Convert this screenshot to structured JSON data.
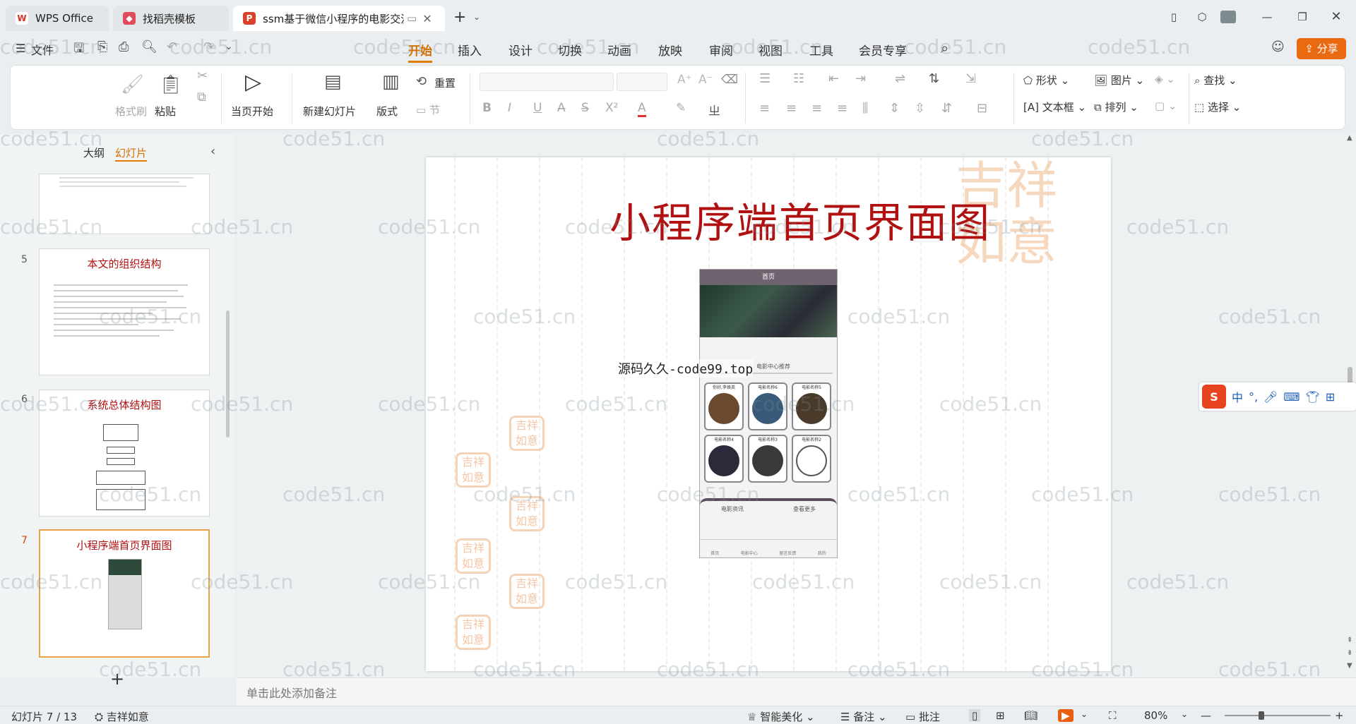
{
  "tabs": [
    {
      "label": "WPS Office",
      "icon": "wps-icon"
    },
    {
      "label": "找稻壳模板",
      "icon": "docer-icon"
    },
    {
      "label": "ssm基于微信小程序的电影交流",
      "icon": "ppt-icon"
    }
  ],
  "menu": {
    "file": "文件",
    "tabs": [
      "开始",
      "插入",
      "设计",
      "切换",
      "动画",
      "放映",
      "审阅",
      "视图",
      "工具",
      "会员专享"
    ],
    "active": "开始",
    "share": "分享"
  },
  "ribbon": {
    "format_painter": "格式刷",
    "paste": "粘贴",
    "start_from_current": "当页开始",
    "new_slide": "新建幻灯片",
    "layout": "版式",
    "reset": "重置",
    "section": "节",
    "shape": "形状",
    "picture": "图片",
    "textbox": "文本框",
    "arrange": "排列",
    "find": "查找",
    "select": "选择"
  },
  "panel": {
    "outline_tab": "大纲",
    "slides_tab": "幻灯片"
  },
  "thumbs": [
    {
      "num": "5",
      "title": "本文的组织结构"
    },
    {
      "num": "6",
      "title": "系统总体结构图"
    },
    {
      "num": "7",
      "title": "小程序端首页界面图"
    }
  ],
  "slide": {
    "title": "小程序端首页界面图",
    "overlay_text": "源码久久-code99.top"
  },
  "phone": {
    "header": "首页",
    "section": "电影中心推荐",
    "cards": [
      "你好,李焕英",
      "电影名称6",
      "电影名称5",
      "电影名称4",
      "电影名称3",
      "电影名称2"
    ],
    "news": "电影资讯",
    "more": "查看更多",
    "nav": [
      "首页",
      "电影中心",
      "留言反馈",
      "我的"
    ]
  },
  "notes": {
    "placeholder": "单击此处添加备注"
  },
  "status": {
    "slide_count": "幻灯片 7 / 13",
    "theme": "吉祥如意",
    "beautify": "智能美化",
    "notes": "备注",
    "comment": "批注",
    "zoom": "80%"
  },
  "watermark": "code51.cn",
  "ime": {
    "lang": "中"
  }
}
